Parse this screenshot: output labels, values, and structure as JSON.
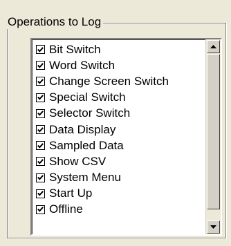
{
  "group": {
    "title": "Operations to Log"
  },
  "items": [
    {
      "label": "Bit Switch",
      "checked": true
    },
    {
      "label": "Word Switch",
      "checked": true
    },
    {
      "label": "Change Screen Switch",
      "checked": true
    },
    {
      "label": "Special Switch",
      "checked": true
    },
    {
      "label": "Selector Switch",
      "checked": true
    },
    {
      "label": "Data Display",
      "checked": true
    },
    {
      "label": "Sampled Data",
      "checked": true
    },
    {
      "label": "Show CSV",
      "checked": true
    },
    {
      "label": "System Menu",
      "checked": true
    },
    {
      "label": "Start Up",
      "checked": true
    },
    {
      "label": "Offline",
      "checked": true
    }
  ],
  "icons": {
    "checkmark": "check-icon",
    "scroll_up": "arrow-up-icon",
    "scroll_down": "arrow-down-icon"
  }
}
